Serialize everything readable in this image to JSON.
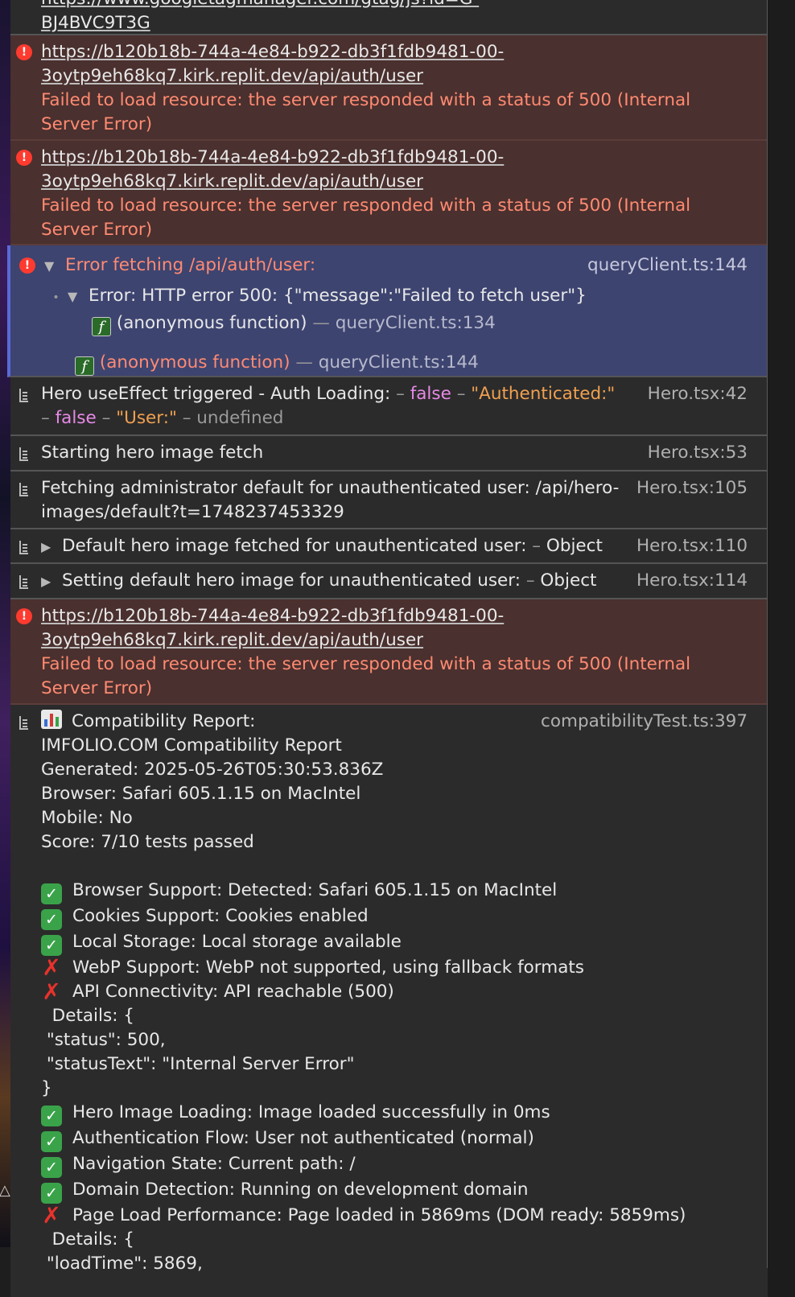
{
  "top_row": {
    "url_line1": "https://www.googletagmanager.com/gtag/js?id=G-",
    "url_line2": "BJ4BVC9T3G"
  },
  "error_rows": [
    {
      "url_line1": "https://b120b18b-744a-4e84-b922-db3f1fdb9481-00-",
      "url_line2": "3oytp9eh68kq7.kirk.replit.dev/api/auth/user",
      "text_line1": "Failed to load resource: the server responded with a status of 500 (Internal",
      "text_line2": "Server Error)"
    },
    {
      "url_line1": "https://b120b18b-744a-4e84-b922-db3f1fdb9481-00-",
      "url_line2": "3oytp9eh68kq7.kirk.replit.dev/api/auth/user",
      "text_line1": "Failed to load resource: the server responded with a status of 500 (Internal",
      "text_line2": "Server Error)"
    },
    {
      "url_line1": "https://b120b18b-744a-4e84-b922-db3f1fdb9481-00-",
      "url_line2": "3oytp9eh68kq7.kirk.replit.dev/api/auth/user",
      "text_line1": "Failed to load resource: the server responded with a status of 500 (Internal",
      "text_line2": "Server Error)"
    }
  ],
  "selected_error": {
    "title": "Error fetching /api/auth/user:",
    "source": "queryClient.ts:144",
    "error_message": "Error: HTTP error 500: {\"message\":\"Failed to fetch user\"}",
    "frame1_name": "(anonymous function)",
    "frame1_src": "queryClient.ts:134",
    "frame2_name": "(anonymous function)",
    "frame2_src": "queryClient.ts:144",
    "sep": "—",
    "fn_glyph": "f"
  },
  "hero_effect": {
    "prefix": "Hero useEffect triggered - Auth Loading:",
    "dash": "–",
    "val_false": "false",
    "authenticated": "\"Authenticated:\"",
    "user": "\"User:\"",
    "undefined": "undefined",
    "source": "Hero.tsx:42"
  },
  "hero_start": {
    "text": "Starting hero image fetch",
    "source": "Hero.tsx:53"
  },
  "hero_admin": {
    "line1": "Fetching administrator default for unauthenticated user: /api/hero-",
    "line2": "images/default?t=1748237453329",
    "source": "Hero.tsx:105"
  },
  "hero_fetched": {
    "text": "Default hero image fetched for unauthenticated user:",
    "dash": "–",
    "object": "Object",
    "source": "Hero.tsx:110"
  },
  "hero_setting": {
    "text": "Setting default hero image for unauthenticated user:",
    "dash": "–",
    "object": "Object",
    "source": "Hero.tsx:114"
  },
  "compat": {
    "header": "Compatibility Report:",
    "source": "compatibilityTest.ts:397",
    "title": "IMFOLIO.COM Compatibility Report",
    "generated": "Generated: 2025-05-26T05:30:53.836Z",
    "browser": "Browser: Safari 605.1.15 on MacIntel",
    "mobile": "Mobile: No",
    "score": "Score: 7/10 tests passed",
    "tests": [
      {
        "pass": true,
        "text": "Browser Support: Detected: Safari 605.1.15 on MacIntel"
      },
      {
        "pass": true,
        "text": "Cookies Support: Cookies enabled"
      },
      {
        "pass": true,
        "text": "Local Storage: Local storage available"
      },
      {
        "pass": false,
        "text": "WebP Support: WebP not supported, using fallback formats"
      },
      {
        "pass": false,
        "text": "API Connectivity: API reachable (500)"
      }
    ],
    "details1": [
      "  Details: {",
      " \"status\": 500,",
      " \"statusText\": \"Internal Server Error\"",
      "}"
    ],
    "tests2": [
      {
        "pass": true,
        "text": "Hero Image Loading: Image loaded successfully in 0ms"
      },
      {
        "pass": true,
        "text": "Authentication Flow: User not authenticated (normal)"
      },
      {
        "pass": true,
        "text": "Navigation State: Current path: /"
      },
      {
        "pass": true,
        "text": "Domain Detection: Running on development domain"
      },
      {
        "pass": false,
        "text": "Page Load Performance: Page loaded in 5869ms (DOM ready: 5859ms)"
      }
    ],
    "details2": [
      "  Details: {",
      " \"loadTime\": 5869,"
    ]
  },
  "glyphs": {
    "check": "✓",
    "cross": "✗",
    "error": "!",
    "tri_down": "▼",
    "tri_right": "▶",
    "bullet": "•"
  },
  "colors": {
    "error_bg": "#4a302e",
    "selected_bg": "#3d4470",
    "error_text": "#ff8a72",
    "keyword_pink": "#e78ae7",
    "string_orange": "#f0a050"
  }
}
